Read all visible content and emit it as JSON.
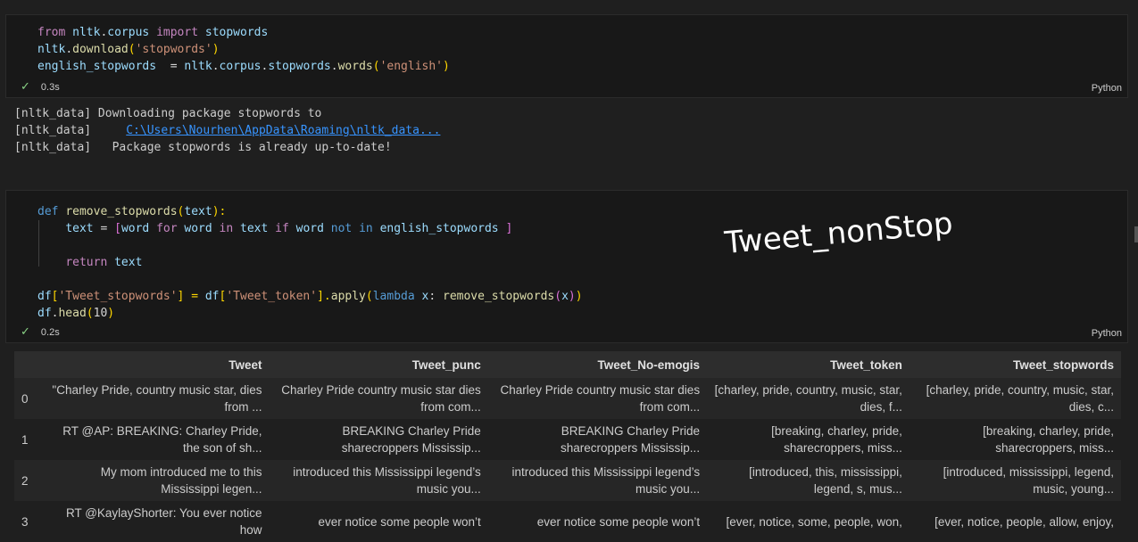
{
  "cell1": {
    "lines": [
      [
        {
          "t": "from",
          "c": "kw"
        },
        {
          "t": " ",
          "c": "op"
        },
        {
          "t": "nltk",
          "c": "id"
        },
        {
          "t": ".",
          "c": "op"
        },
        {
          "t": "corpus",
          "c": "id"
        },
        {
          "t": " ",
          "c": "op"
        },
        {
          "t": "import",
          "c": "kw"
        },
        {
          "t": " ",
          "c": "op"
        },
        {
          "t": "stopwords",
          "c": "id"
        }
      ],
      [
        {
          "t": "nltk",
          "c": "id"
        },
        {
          "t": ".",
          "c": "op"
        },
        {
          "t": "download",
          "c": "fn"
        },
        {
          "t": "(",
          "c": "par"
        },
        {
          "t": "'stopwords'",
          "c": "str"
        },
        {
          "t": ")",
          "c": "par"
        }
      ],
      [
        {
          "t": "english_stopwords",
          "c": "id"
        },
        {
          "t": "  = ",
          "c": "op"
        },
        {
          "t": "nltk",
          "c": "id"
        },
        {
          "t": ".",
          "c": "op"
        },
        {
          "t": "corpus",
          "c": "id"
        },
        {
          "t": ".",
          "c": "op"
        },
        {
          "t": "stopwords",
          "c": "id"
        },
        {
          "t": ".",
          "c": "op"
        },
        {
          "t": "words",
          "c": "fn"
        },
        {
          "t": "(",
          "c": "par"
        },
        {
          "t": "'english'",
          "c": "str"
        },
        {
          "t": ")",
          "c": "par"
        }
      ]
    ],
    "status_check": "✓",
    "time": "0.3s",
    "language": "Python"
  },
  "output": {
    "line1": "[nltk_data] Downloading package stopwords to",
    "line2_prefix": "[nltk_data]     ",
    "line2_link": "C:\\Users\\Nourhen\\AppData\\Roaming\\nltk_data...",
    "line3": "[nltk_data]   Package stopwords is already up-to-date!"
  },
  "cell2": {
    "lines": [
      [
        {
          "t": "def",
          "c": "kw2"
        },
        {
          "t": " ",
          "c": "op"
        },
        {
          "t": "remove_stopwords",
          "c": "fn"
        },
        {
          "t": "(",
          "c": "par"
        },
        {
          "t": "text",
          "c": "id"
        },
        {
          "t": "):",
          "c": "par"
        }
      ],
      [
        {
          "t": "    ",
          "c": "op"
        },
        {
          "t": "text",
          "c": "id"
        },
        {
          "t": " = ",
          "c": "op"
        },
        {
          "t": "[",
          "c": "brk"
        },
        {
          "t": "word",
          "c": "id"
        },
        {
          "t": " ",
          "c": "op"
        },
        {
          "t": "for",
          "c": "kw"
        },
        {
          "t": " ",
          "c": "op"
        },
        {
          "t": "word",
          "c": "id"
        },
        {
          "t": " ",
          "c": "op"
        },
        {
          "t": "in",
          "c": "kw"
        },
        {
          "t": " ",
          "c": "op"
        },
        {
          "t": "text",
          "c": "id"
        },
        {
          "t": " ",
          "c": "op"
        },
        {
          "t": "if",
          "c": "kw"
        },
        {
          "t": " ",
          "c": "op"
        },
        {
          "t": "word",
          "c": "id"
        },
        {
          "t": " ",
          "c": "op"
        },
        {
          "t": "not",
          "c": "kw2"
        },
        {
          "t": " ",
          "c": "op"
        },
        {
          "t": "in",
          "c": "kw2"
        },
        {
          "t": " ",
          "c": "op"
        },
        {
          "t": "english_stopwords",
          "c": "id"
        },
        {
          "t": " ",
          "c": "op"
        },
        {
          "t": "]",
          "c": "brk"
        }
      ],
      [
        {
          "t": " ",
          "c": "op"
        }
      ],
      [
        {
          "t": "    ",
          "c": "op"
        },
        {
          "t": "return",
          "c": "kw"
        },
        {
          "t": " ",
          "c": "op"
        },
        {
          "t": "text",
          "c": "id"
        }
      ],
      [
        {
          "t": " ",
          "c": "op"
        }
      ],
      [
        {
          "t": "df",
          "c": "id"
        },
        {
          "t": "[",
          "c": "par"
        },
        {
          "t": "'Tweet_stopwords'",
          "c": "str"
        },
        {
          "t": "] = ",
          "c": "par"
        },
        {
          "t": "df",
          "c": "id"
        },
        {
          "t": "[",
          "c": "par"
        },
        {
          "t": "'Tweet_token'",
          "c": "str"
        },
        {
          "t": "].",
          "c": "par"
        },
        {
          "t": "apply",
          "c": "fn"
        },
        {
          "t": "(",
          "c": "par"
        },
        {
          "t": "lambda",
          "c": "kw2"
        },
        {
          "t": " ",
          "c": "op"
        },
        {
          "t": "x",
          "c": "id"
        },
        {
          "t": ": ",
          "c": "op"
        },
        {
          "t": "remove_stopwords",
          "c": "fn"
        },
        {
          "t": "(",
          "c": "brk"
        },
        {
          "t": "x",
          "c": "id"
        },
        {
          "t": ")",
          "c": "brk"
        },
        {
          "t": ")",
          "c": "par"
        }
      ],
      [
        {
          "t": "df",
          "c": "id"
        },
        {
          "t": ".",
          "c": "op"
        },
        {
          "t": "head",
          "c": "fn"
        },
        {
          "t": "(",
          "c": "par"
        },
        {
          "t": "10",
          "c": "op"
        },
        {
          "t": ")",
          "c": "par"
        }
      ]
    ],
    "status_check": "✓",
    "time": "0.2s",
    "language": "Python"
  },
  "annotation": "Tweet_nonStop",
  "table": {
    "columns": [
      "",
      "Tweet",
      "Tweet_punc",
      "Tweet_No-emogis",
      "Tweet_token",
      "Tweet_stopwords"
    ],
    "rows": [
      [
        "0",
        "\"Charley Pride, country music star, dies from ...",
        "Charley Pride country music star dies from com...",
        "Charley Pride country music star dies from com...",
        "[charley, pride, country, music, star, dies, f...",
        "[charley, pride, country, music, star, dies, c..."
      ],
      [
        "1",
        "RT @AP: BREAKING: Charley Pride, the son of sh...",
        "BREAKING Charley Pride sharecroppers Mississip...",
        "BREAKING Charley Pride sharecroppers Mississip...",
        "[breaking, charley, pride, sharecroppers, miss...",
        "[breaking, charley, pride, sharecroppers, miss..."
      ],
      [
        "2",
        "My mom introduced me to this Mississippi legen...",
        "introduced this Mississippi legend’s music you...",
        "introduced this Mississippi legend’s music you...",
        "[introduced, this, mississippi, legend, s, mus...",
        "[introduced, mississippi, legend, music, young..."
      ],
      [
        "3",
        "RT @KaylayShorter: You ever notice how",
        "ever notice some people won’t",
        "ever notice some people won’t",
        "[ever, notice, some, people, won,",
        "[ever, notice, people, allow, enjoy,"
      ]
    ]
  }
}
